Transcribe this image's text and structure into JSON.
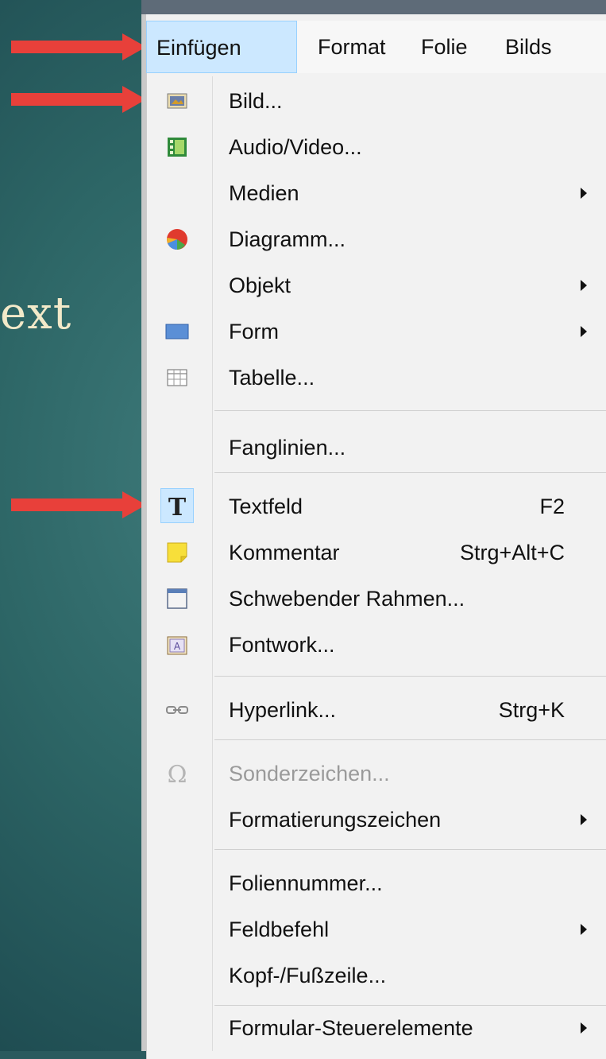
{
  "slide": {
    "text": "ext"
  },
  "menubar": {
    "items": [
      "Einfügen",
      "Format",
      "Folie",
      "Bilds"
    ]
  },
  "menu": {
    "items": [
      {
        "label": "Bild...",
        "shortcut": "",
        "submenu": false,
        "icon": "image-icon"
      },
      {
        "label": "Audio/Video...",
        "shortcut": "",
        "submenu": false,
        "icon": "film-icon"
      },
      {
        "label": "Medien",
        "shortcut": "",
        "submenu": true,
        "icon": ""
      },
      {
        "label": "Diagramm...",
        "shortcut": "",
        "submenu": false,
        "icon": "pie-chart-icon"
      },
      {
        "label": "Objekt",
        "shortcut": "",
        "submenu": true,
        "icon": ""
      },
      {
        "label": "Form",
        "shortcut": "",
        "submenu": true,
        "icon": "rectangle-icon"
      },
      {
        "label": "Tabelle...",
        "shortcut": "",
        "submenu": false,
        "icon": "table-icon"
      },
      {
        "label": "Fanglinien...",
        "shortcut": "",
        "submenu": false,
        "icon": ""
      },
      {
        "label": "Textfeld",
        "shortcut": "F2",
        "submenu": false,
        "icon": "text-t-icon"
      },
      {
        "label": "Kommentar",
        "shortcut": "Strg+Alt+C",
        "submenu": false,
        "icon": "sticky-note-icon"
      },
      {
        "label": "Schwebender Rahmen...",
        "shortcut": "",
        "submenu": false,
        "icon": "frame-icon"
      },
      {
        "label": "Fontwork...",
        "shortcut": "",
        "submenu": false,
        "icon": "fontwork-icon"
      },
      {
        "label": "Hyperlink...",
        "shortcut": "Strg+K",
        "submenu": false,
        "icon": "hyperlink-icon"
      },
      {
        "label": "Sonderzeichen...",
        "shortcut": "",
        "submenu": false,
        "icon": "omega-icon",
        "disabled": true
      },
      {
        "label": "Formatierungszeichen",
        "shortcut": "",
        "submenu": true,
        "icon": ""
      },
      {
        "label": "Foliennummer...",
        "shortcut": "",
        "submenu": false,
        "icon": ""
      },
      {
        "label": "Feldbefehl",
        "shortcut": "",
        "submenu": true,
        "icon": ""
      },
      {
        "label": "Kopf-/Fußzeile...",
        "shortcut": "",
        "submenu": false,
        "icon": ""
      },
      {
        "label": "Formular-Steuerelemente",
        "shortcut": "",
        "submenu": true,
        "icon": ""
      }
    ]
  },
  "colors": {
    "arrow": "#e8403a",
    "highlight": "#cce8ff"
  }
}
